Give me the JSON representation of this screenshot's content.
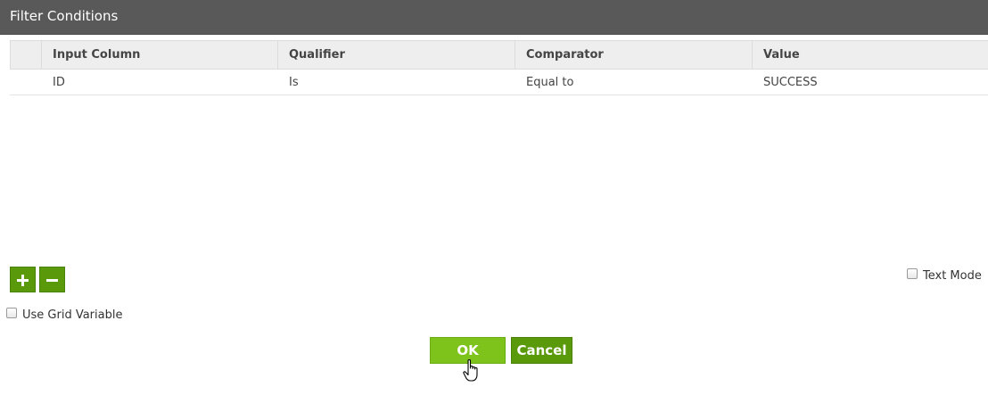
{
  "dialog": {
    "title": "Filter Conditions"
  },
  "grid": {
    "columns": [
      "Input Column",
      "Qualifier",
      "Comparator",
      "Value"
    ],
    "rows": [
      {
        "input_column": "ID",
        "qualifier": "Is",
        "comparator": "Equal to",
        "value": "SUCCESS"
      }
    ]
  },
  "controls": {
    "add_icon": "plus-icon",
    "remove_icon": "minus-icon",
    "text_mode_label": "Text Mode",
    "text_mode_checked": false,
    "use_grid_variable_label": "Use Grid Variable",
    "use_grid_variable_checked": false
  },
  "buttons": {
    "ok_label": "OK",
    "cancel_label": "Cancel"
  },
  "colors": {
    "title_bar": "#595959",
    "ok_button": "#7ec21c",
    "action_button": "#5a9a0a"
  }
}
